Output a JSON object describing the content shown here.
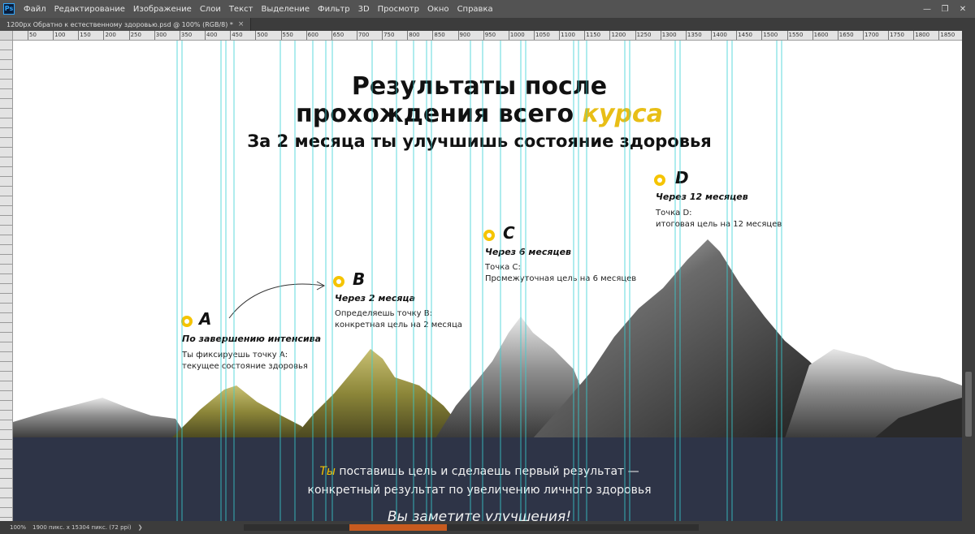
{
  "menu": {
    "logo": "Ps",
    "items": [
      "Файл",
      "Редактирование",
      "Изображение",
      "Слои",
      "Текст",
      "Выделение",
      "Фильтр",
      "3D",
      "Просмотр",
      "Окно",
      "Справка"
    ],
    "window_controls": [
      "minimize-icon",
      "restore-icon",
      "close-icon"
    ]
  },
  "tab": {
    "title": "1200px Обратно к естественному здоровью.psd @ 100% (RGB/8) *",
    "close": "×"
  },
  "ruler": {
    "ticks": [
      "50",
      "100",
      "150",
      "200",
      "250",
      "300",
      "350",
      "400",
      "450",
      "500",
      "550",
      "600",
      "650",
      "700",
      "750",
      "800",
      "850",
      "900",
      "950",
      "1000",
      "1050",
      "1100",
      "1150",
      "1200",
      "1250",
      "1300",
      "1350",
      "1400",
      "1450",
      "1500",
      "1550",
      "1600",
      "1650",
      "1700",
      "1750",
      "1800",
      "1850"
    ]
  },
  "canvas": {
    "title_line1": "Результаты после",
    "title_line2_main": "прохождения всего ",
    "title_line2_accent": "курса",
    "subtitle": "За 2 месяца ты улучшишь состояние здоровья",
    "points": [
      {
        "letter": "A",
        "when": "По завершению интенсива",
        "desc1": "Ты фиксируешь точку А:",
        "desc2": "текущее состояние здоровья"
      },
      {
        "letter": "B",
        "when": "Через 2 месяца",
        "desc1": "Определяешь точку В:",
        "desc2": "конкретная цель на 2 месяца"
      },
      {
        "letter": "C",
        "when": "Через 6 месяцев",
        "desc1": "Точка С:",
        "desc2": "Промежуточная цель на 6 месяцев"
      },
      {
        "letter": "D",
        "when": "Через 12 месяцев",
        "desc1": "Точка D:",
        "desc2": "итоговая цель на 12 месяцев"
      }
    ],
    "band": {
      "accent": "Ты",
      "line1_rest": " поставишь цель и сделаешь первый результат —",
      "line2": "конкретный результат по увеличению личного здоровья",
      "cut": "Вы заметите улучшения!"
    },
    "colors": {
      "accent": "#f5c400",
      "band": "#2e3447",
      "guides": "#37d0d4"
    }
  },
  "status": {
    "zoom": "100%",
    "doc_info": "1900 пикс. x 15304 пикс. (72 ppi)",
    "arrow": "❯"
  }
}
